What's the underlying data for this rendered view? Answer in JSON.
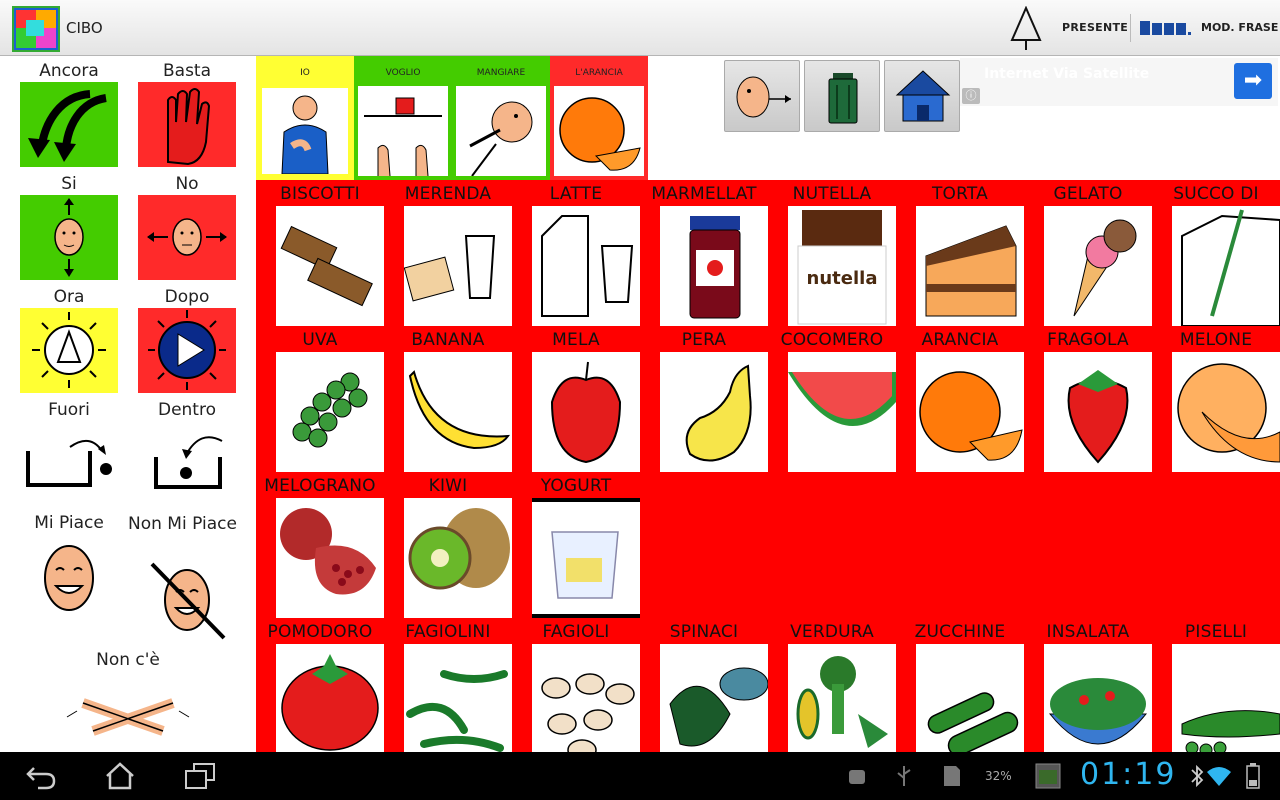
{
  "app": {
    "title": "CIBO",
    "tense_label": "PRESENTE",
    "mode_label": "MOD. FRASE",
    "icons": {
      "app": "app-logo-icon",
      "tense": "tense-tree-icon",
      "mode": "sentence-mode-icon"
    }
  },
  "quick": {
    "ancora": "Ancora",
    "basta": "Basta",
    "si": "Si",
    "no": "No",
    "ora": "Ora",
    "dopo": "Dopo",
    "fuori": "Fuori",
    "dentro": "Dentro",
    "mi_piace": "Mi Piace",
    "non_mi_piace": "Non Mi Piace",
    "non_ce": "Non c'è"
  },
  "phrase": {
    "io": "IO",
    "voglio": "VOGLIO",
    "mangiare": "MANGIARE",
    "arancia": "L'ARANCIA"
  },
  "toolbar": {
    "speak_icon": "speak-icon",
    "trash_icon": "trash-bin-icon",
    "home_icon": "home-icon"
  },
  "ad": {
    "text": "Internet Via Satellite"
  },
  "grid": {
    "row1": [
      "BISCOTTI",
      "MERENDA",
      "LATTE",
      "MARMELLAT",
      "NUTELLA",
      "TORTA",
      "GELATO",
      "SUCCO DI"
    ],
    "row2": [
      "UVA",
      "BANANA",
      "MELA",
      "PERA",
      "COCOMERO",
      "ARANCIA",
      "FRAGOLA",
      "MELONE"
    ],
    "row3": [
      "MELOGRANO",
      "KIWI",
      "YOGURT"
    ],
    "row4": [
      "POMODORO",
      "FAGIOLINI",
      "FAGIOLI",
      "SPINACI",
      "VERDURA",
      "ZUCCHINE",
      "INSALATA",
      "PISELLI"
    ]
  },
  "status": {
    "battery_percent": "32%",
    "time": "01:19"
  },
  "colors": {
    "grid_bg": "#ff0000",
    "green": "#44cc00",
    "red": "#ff2a2a",
    "yellow": "#ffff33",
    "clock": "#2fb6f0"
  }
}
